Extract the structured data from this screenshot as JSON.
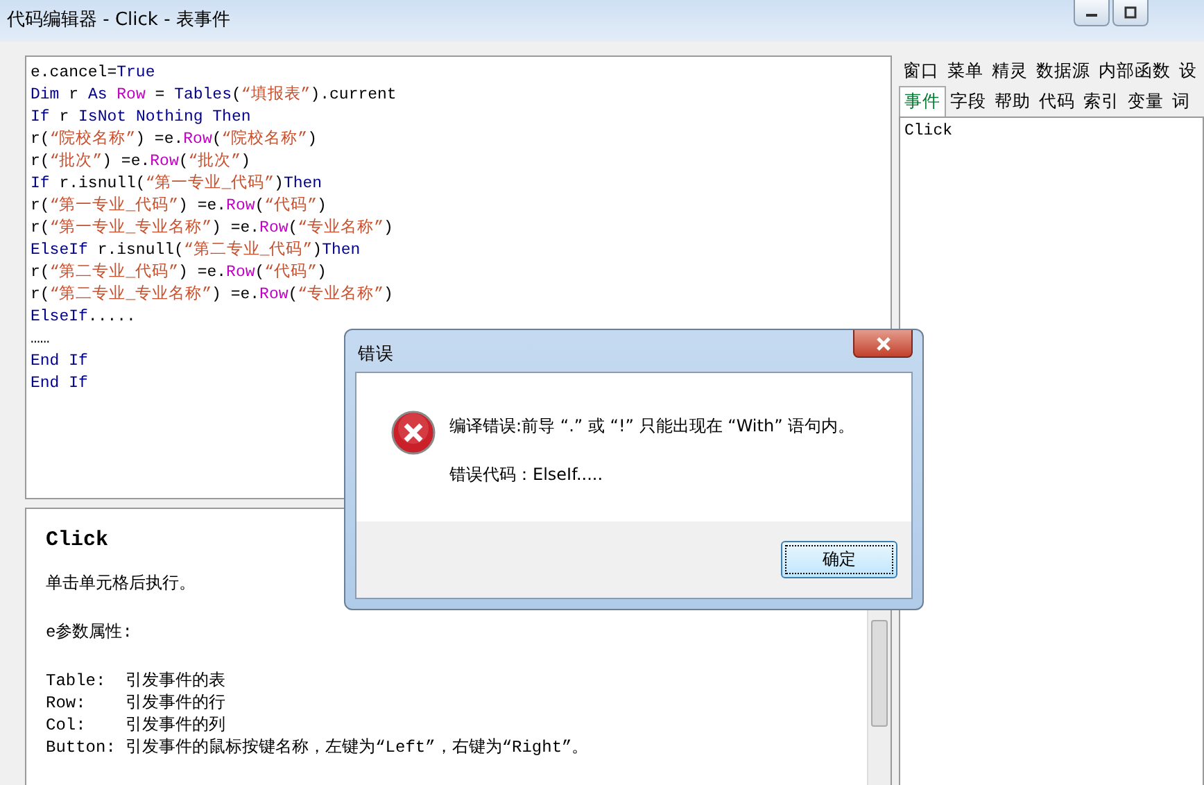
{
  "window": {
    "title": "代码编辑器 - Click - 表事件"
  },
  "code_lines": [
    [
      {
        "kind": "plain",
        "text": "e.cancel="
      },
      {
        "kind": "keyword",
        "text": "True"
      }
    ],
    [
      {
        "kind": "keyword",
        "text": "Dim"
      },
      {
        "kind": "plain",
        "text": " r "
      },
      {
        "kind": "keyword",
        "text": "As"
      },
      {
        "kind": "type",
        "text": " Row"
      },
      {
        "kind": "plain",
        "text": " = "
      },
      {
        "kind": "keyword",
        "text": "Tables"
      },
      {
        "kind": "plain",
        "text": "("
      },
      {
        "kind": "string",
        "text": "“填报表”"
      },
      {
        "kind": "plain",
        "text": ").current"
      }
    ],
    [
      {
        "kind": "keyword",
        "text": "If"
      },
      {
        "kind": "plain",
        "text": " r "
      },
      {
        "kind": "keyword",
        "text": "IsNot Nothing Then"
      }
    ],
    [
      {
        "kind": "plain",
        "text": "r("
      },
      {
        "kind": "string",
        "text": "“院校名称”"
      },
      {
        "kind": "plain",
        "text": ") =e."
      },
      {
        "kind": "type",
        "text": "Row"
      },
      {
        "kind": "plain",
        "text": "("
      },
      {
        "kind": "string",
        "text": "“院校名称”"
      },
      {
        "kind": "plain",
        "text": ")"
      }
    ],
    [
      {
        "kind": "plain",
        "text": "r("
      },
      {
        "kind": "string",
        "text": "“批次”"
      },
      {
        "kind": "plain",
        "text": ") =e."
      },
      {
        "kind": "type",
        "text": "Row"
      },
      {
        "kind": "plain",
        "text": "("
      },
      {
        "kind": "string",
        "text": "“批次”"
      },
      {
        "kind": "plain",
        "text": ")"
      }
    ],
    [
      {
        "kind": "keyword",
        "text": "If"
      },
      {
        "kind": "plain",
        "text": " r.isnull("
      },
      {
        "kind": "string",
        "text": "“第一专业_代码”"
      },
      {
        "kind": "plain",
        "text": ")"
      },
      {
        "kind": "keyword",
        "text": "Then"
      }
    ],
    [
      {
        "kind": "plain",
        "text": "r("
      },
      {
        "kind": "string",
        "text": "“第一专业_代码”"
      },
      {
        "kind": "plain",
        "text": ") =e."
      },
      {
        "kind": "type",
        "text": "Row"
      },
      {
        "kind": "plain",
        "text": "("
      },
      {
        "kind": "string",
        "text": "“代码”"
      },
      {
        "kind": "plain",
        "text": ")"
      }
    ],
    [
      {
        "kind": "plain",
        "text": "r("
      },
      {
        "kind": "string",
        "text": "“第一专业_专业名称”"
      },
      {
        "kind": "plain",
        "text": ") =e."
      },
      {
        "kind": "type",
        "text": "Row"
      },
      {
        "kind": "plain",
        "text": "("
      },
      {
        "kind": "string",
        "text": "“专业名称”"
      },
      {
        "kind": "plain",
        "text": ")"
      }
    ],
    [
      {
        "kind": "keyword",
        "text": "ElseIf"
      },
      {
        "kind": "plain",
        "text": " r.isnull("
      },
      {
        "kind": "string",
        "text": "“第二专业_代码”"
      },
      {
        "kind": "plain",
        "text": ")"
      },
      {
        "kind": "keyword",
        "text": "Then"
      }
    ],
    [
      {
        "kind": "plain",
        "text": "r("
      },
      {
        "kind": "string",
        "text": "“第二专业_代码”"
      },
      {
        "kind": "plain",
        "text": ") =e."
      },
      {
        "kind": "type",
        "text": "Row"
      },
      {
        "kind": "plain",
        "text": "("
      },
      {
        "kind": "string",
        "text": "“代码”"
      },
      {
        "kind": "plain",
        "text": ")"
      }
    ],
    [
      {
        "kind": "plain",
        "text": "r("
      },
      {
        "kind": "string",
        "text": "“第二专业_专业名称”"
      },
      {
        "kind": "plain",
        "text": ") =e."
      },
      {
        "kind": "type",
        "text": "Row"
      },
      {
        "kind": "plain",
        "text": "("
      },
      {
        "kind": "string",
        "text": "“专业名称”"
      },
      {
        "kind": "plain",
        "text": ")"
      }
    ],
    [
      {
        "kind": "keyword",
        "text": "ElseIf"
      },
      {
        "kind": "plain",
        "text": "....."
      }
    ],
    [
      {
        "kind": "plain",
        "text": "……"
      }
    ],
    [
      {
        "kind": "keyword",
        "text": "End If"
      }
    ],
    [
      {
        "kind": "keyword",
        "text": "End If"
      }
    ]
  ],
  "help": {
    "title": "Click",
    "paragraphs": [
      [
        "单击单元格后执行。"
      ],
      [
        "e参数属性:"
      ],
      [
        "Table:  引发事件的表",
        "Row:    引发事件的行",
        "Col:    引发事件的列",
        "Button: 引发事件的鼠标按键名称，左键为“Left”，右键为“Right”。"
      ]
    ]
  },
  "side_tabs_row_1": [
    {
      "label": "窗口",
      "selected": false
    },
    {
      "label": "菜单",
      "selected": false
    },
    {
      "label": "精灵",
      "selected": false
    },
    {
      "label": "数据源",
      "selected": false
    },
    {
      "label": "内部函数",
      "selected": false
    },
    {
      "label": "设",
      "selected": false
    }
  ],
  "side_tabs_row_2": [
    {
      "label": "事件",
      "selected": true
    },
    {
      "label": "字段",
      "selected": false
    },
    {
      "label": "帮助",
      "selected": false
    },
    {
      "label": "代码",
      "selected": false
    },
    {
      "label": "索引",
      "selected": false
    },
    {
      "label": "变量",
      "selected": false
    },
    {
      "label": "词",
      "selected": false
    }
  ],
  "event_list": [
    {
      "label": "Click",
      "selected": false
    }
  ],
  "dialog": {
    "title": "错误",
    "message": "编译错误:前导 “.” 或 “!” 只能出现在 “With” 语句内。",
    "detail": "错误代码：ElseIf.....",
    "button": "确定"
  }
}
